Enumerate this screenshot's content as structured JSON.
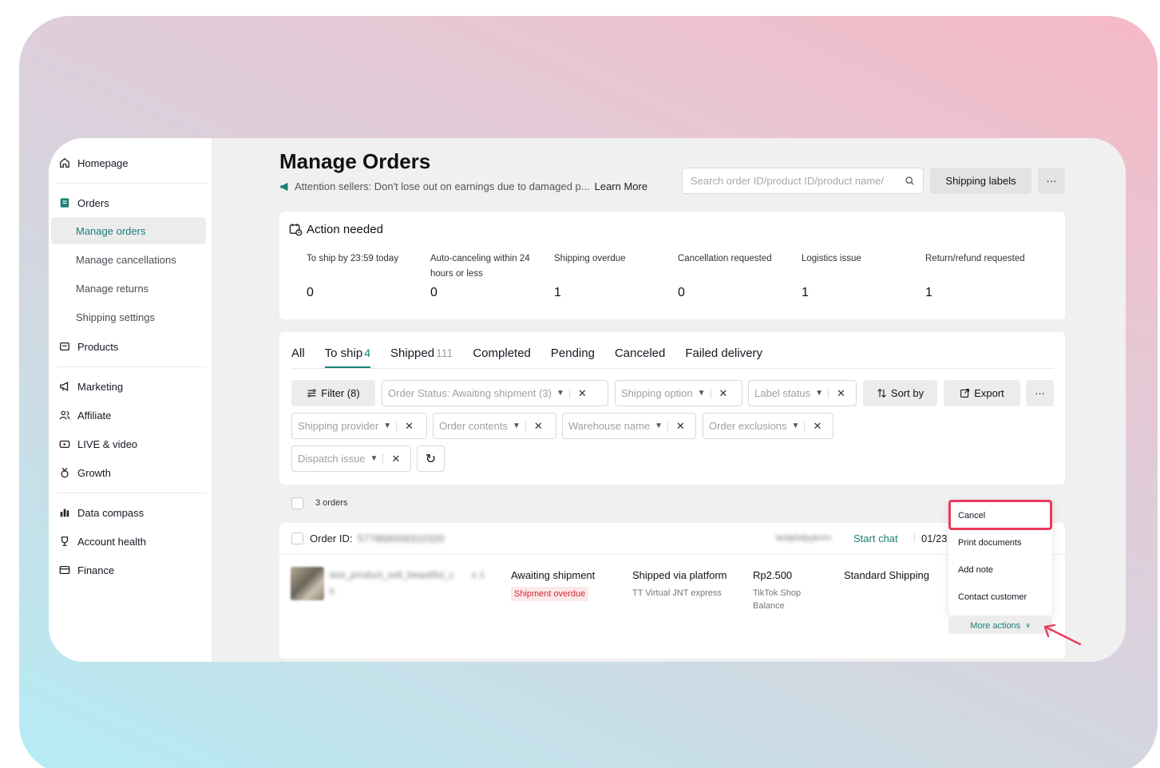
{
  "sidebar": {
    "homepage": "Homepage",
    "orders": "Orders",
    "manage_orders": "Manage orders",
    "manage_cancellations": "Manage cancellations",
    "manage_returns": "Manage returns",
    "shipping_settings": "Shipping settings",
    "products": "Products",
    "marketing": "Marketing",
    "affiliate": "Affiliate",
    "live_video": "LIVE & video",
    "growth": "Growth",
    "data_compass": "Data compass",
    "account_health": "Account health",
    "finance": "Finance"
  },
  "header": {
    "title": "Manage Orders",
    "notice": "Attention sellers: Don't lose out on earnings due to damaged p...",
    "learn_more": "Learn More",
    "search_placeholder": "Search order ID/product ID/product name/",
    "shipping_labels": "Shipping labels",
    "more": "···"
  },
  "action_needed": {
    "title": "Action needed",
    "items": [
      {
        "label": "To ship by 23:59 today",
        "value": "0"
      },
      {
        "label": "Auto-canceling within 24 hours or less",
        "value": "0"
      },
      {
        "label": "Shipping overdue",
        "value": "1"
      },
      {
        "label": "Cancellation requested",
        "value": "0"
      },
      {
        "label": "Logistics issue",
        "value": "1"
      },
      {
        "label": "Return/refund requested",
        "value": "1"
      }
    ]
  },
  "tabs": [
    {
      "label": "All",
      "count": ""
    },
    {
      "label": "To ship",
      "count": "4"
    },
    {
      "label": "Shipped",
      "count": "111"
    },
    {
      "label": "Completed",
      "count": ""
    },
    {
      "label": "Pending",
      "count": ""
    },
    {
      "label": "Canceled",
      "count": ""
    },
    {
      "label": "Failed delivery",
      "count": ""
    }
  ],
  "filters": {
    "filter_button": "Filter  (8)",
    "order_status": "Order Status:  Awaiting shipment (3)",
    "shipping_option": "Shipping option",
    "label_status": "Label status",
    "sort_by": "Sort by",
    "export": "Export",
    "more": "···",
    "shipping_provider": "Shipping provider",
    "order_contents": "Order contents",
    "warehouse_name": "Warehouse name",
    "order_exclusions": "Order exclusions",
    "dispatch_issue": "Dispatch issue",
    "close": "✕",
    "reset": "↻"
  },
  "orders_count": "3 orders",
  "order": {
    "id_label": "Order ID:",
    "id_value": "577868009310320",
    "buyer": "testphdpyknrn",
    "start_chat": "Start chat",
    "date": "01/23",
    "product_name": "test_product_sell_beautiful_c",
    "qty": "x 1",
    "product_sub": "b",
    "status": "Awaiting shipment",
    "status_badge": "Shipment overdue",
    "shipping": "Shipped via platform",
    "carrier": "TT Virtual JNT express",
    "price": "Rp2.500",
    "payment_line1": "TikTok Shop",
    "payment_line2": "Balance",
    "shipping_type": "Standard Shipping"
  },
  "menu": {
    "cancel": "Cancel",
    "print_documents": "Print documents",
    "add_note": "Add note",
    "contact_customer": "Contact customer",
    "more_actions": "More actions"
  },
  "colors": {
    "accent": "#1a7f78",
    "highlight": "#ea3a5c",
    "badge_red": "#d1293b"
  }
}
